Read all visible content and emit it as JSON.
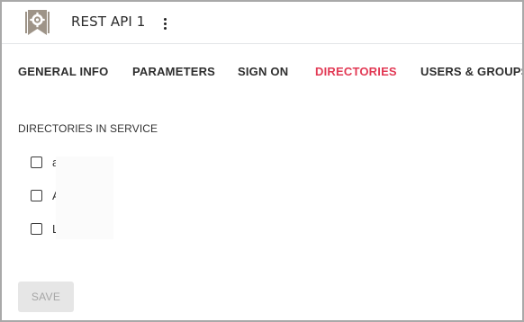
{
  "app": {
    "title": "REST API 1",
    "logo_icon": "rest-api-gear-bookmark-icon",
    "menu_icon": "more-vertical-icon"
  },
  "tabs": [
    {
      "label": "GENERAL INFO",
      "active": false
    },
    {
      "label": "PARAMETERS",
      "active": false
    },
    {
      "label": "SIGN ON",
      "active": false
    },
    {
      "label": "DIRECTORIES",
      "active": true
    },
    {
      "label": "USERS & GROUPS",
      "active": false
    }
  ],
  "directories": {
    "section_title": "DIRECTORIES IN SERVICE",
    "items": [
      {
        "label": "a",
        "checked": false
      },
      {
        "label": "A          5",
        "checked": false
      },
      {
        "label": "L",
        "checked": false
      }
    ]
  },
  "actions": {
    "save_label": "SAVE",
    "save_enabled": false
  },
  "colors": {
    "active_tab": "#e23a55",
    "text": "#2e2e2e",
    "disabled_button_bg": "#e6e6e6",
    "disabled_button_text": "#a6a6a6",
    "logo_fill": "#9e9488"
  }
}
